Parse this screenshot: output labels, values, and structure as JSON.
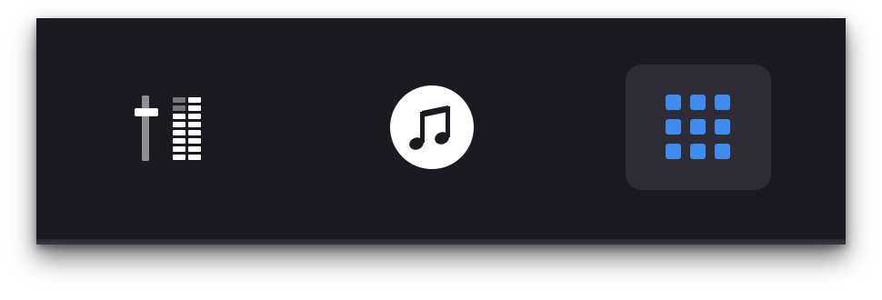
{
  "toolbar": {
    "selected_index": 2,
    "accent_color": "#3f8cf0",
    "background_color": "#1c1a21",
    "active_tab_background": "#2e2d36",
    "icon_color": "#ffffff",
    "items": [
      {
        "icon": "mixer-faders-icon",
        "label": ""
      },
      {
        "icon": "music-note-icon",
        "label": ""
      },
      {
        "icon": "app-grid-icon",
        "label": ""
      }
    ]
  }
}
